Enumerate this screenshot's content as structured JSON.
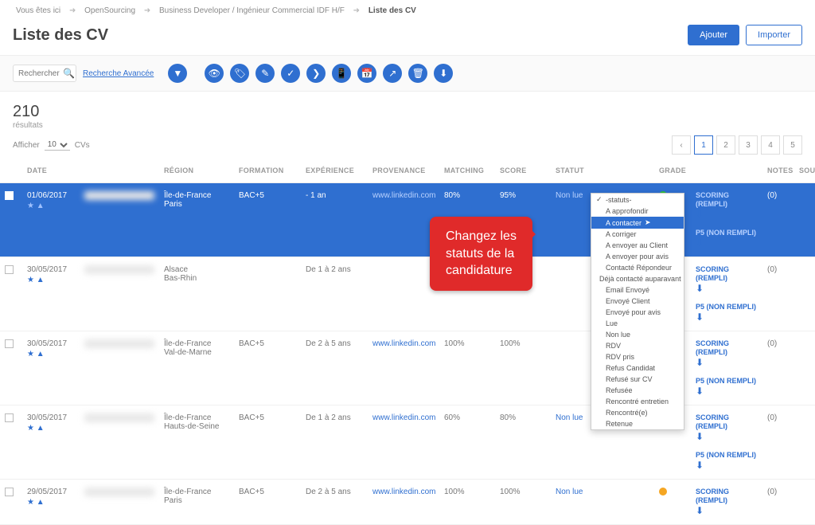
{
  "breadcrumbs": {
    "prefix": "Vous êtes ici",
    "items": [
      "OpenSourcing",
      "Business Developer / Ingénieur Commercial IDF H/F"
    ],
    "current": "Liste des CV"
  },
  "page_title": "Liste des CV",
  "buttons": {
    "add": "Ajouter",
    "import": "Importer"
  },
  "toolbar": {
    "search_placeholder": "Rechercher",
    "advanced": "Recherche Avancée",
    "icons": [
      "filter",
      "eye",
      "tag",
      "edit",
      "qualify",
      "label",
      "mobile",
      "calendar",
      "share",
      "trash",
      "download"
    ]
  },
  "results": {
    "count": "210",
    "label": "résultats",
    "afficher_label": "Afficher",
    "per_page": "10",
    "unit": "CVs"
  },
  "pagination": {
    "pages": [
      "‹",
      "1",
      "2",
      "3",
      "4",
      "5"
    ],
    "current": "1"
  },
  "columns": [
    "",
    "DATE",
    "",
    "RÉGION",
    "FORMATION",
    "EXPÉRIENCE",
    "PROVENANCE",
    "MATCHING",
    "SCORE",
    "STATUT",
    "GRADE",
    "",
    "NOTES",
    "SOURCE"
  ],
  "rows": [
    {
      "date": "01/06/2017",
      "region1": "Île-de-France",
      "region2": "Paris",
      "formation": "BAC+5",
      "experience": "- 1 an",
      "provenance": "www.linkedin.com",
      "matching": "80%",
      "score": "95%",
      "statut": "Non lue",
      "grade": "green",
      "scoring1": "SCORING (REMPLI)",
      "scoring2": "P5 (NON REMPLI)",
      "notes": "(0)",
      "selected": true
    },
    {
      "date": "30/05/2017",
      "region1": "Alsace",
      "region2": "Bas-Rhin",
      "formation": "",
      "experience": "De 1 à 2 ans",
      "provenance": "",
      "matching": "",
      "score": "",
      "statut": "",
      "grade": "amber",
      "scoring1": "SCORING (REMPLI)",
      "scoring2": "P5 (NON REMPLI)",
      "notes": "(0)"
    },
    {
      "date": "30/05/2017",
      "region1": "Île-de-France",
      "region2": "Val-de-Marne",
      "formation": "BAC+5",
      "experience": "De 2 à 5 ans",
      "provenance": "www.linkedin.com",
      "matching": "100%",
      "score": "100%",
      "statut": "",
      "grade": "amber",
      "scoring1": "SCORING (REMPLI)",
      "scoring2": "P5 (NON REMPLI)",
      "notes": "(0)"
    },
    {
      "date": "30/05/2017",
      "region1": "Île-de-France",
      "region2": "Hauts-de-Seine",
      "formation": "BAC+5",
      "experience": "De 1 à 2 ans",
      "provenance": "www.linkedin.com",
      "matching": "60%",
      "score": "80%",
      "statut": "Non lue",
      "grade": "",
      "scoring1": "SCORING (REMPLI)",
      "scoring2": "P5 (NON REMPLI)",
      "notes": "(0)"
    },
    {
      "date": "29/05/2017",
      "region1": "Île-de-France",
      "region2": "Paris",
      "formation": "BAC+5",
      "experience": "De 2 à 5 ans",
      "provenance": "www.linkedin.com",
      "matching": "100%",
      "score": "100%",
      "statut": "Non lue",
      "grade": "amber",
      "scoring1": "SCORING (REMPLI)",
      "scoring2": "",
      "notes": "(0)"
    }
  ],
  "callout": {
    "l1": "Changez les",
    "l2": "statuts de la",
    "l3": "candidature"
  },
  "status_options": [
    {
      "label": "-statuts-",
      "checked": true,
      "hi": false
    },
    {
      "label": "A approfondir"
    },
    {
      "label": "A contacter",
      "hi": true
    },
    {
      "label": "A corriger"
    },
    {
      "label": "A envoyer au Client"
    },
    {
      "label": "A envoyer pour avis"
    },
    {
      "label": "Contacté Répondeur"
    },
    {
      "label": "Déjà contacté auparavant"
    },
    {
      "label": "Email Envoyé"
    },
    {
      "label": "Envoyé Client"
    },
    {
      "label": "Envoyé pour avis"
    },
    {
      "label": "Lue"
    },
    {
      "label": "Non lue"
    },
    {
      "label": "RDV"
    },
    {
      "label": "RDV pris"
    },
    {
      "label": "Refus Candidat"
    },
    {
      "label": "Refusé sur CV"
    },
    {
      "label": "Refusée"
    },
    {
      "label": "Rencontré entretien"
    },
    {
      "label": "Rencontré(e)"
    },
    {
      "label": "Retenue"
    }
  ]
}
